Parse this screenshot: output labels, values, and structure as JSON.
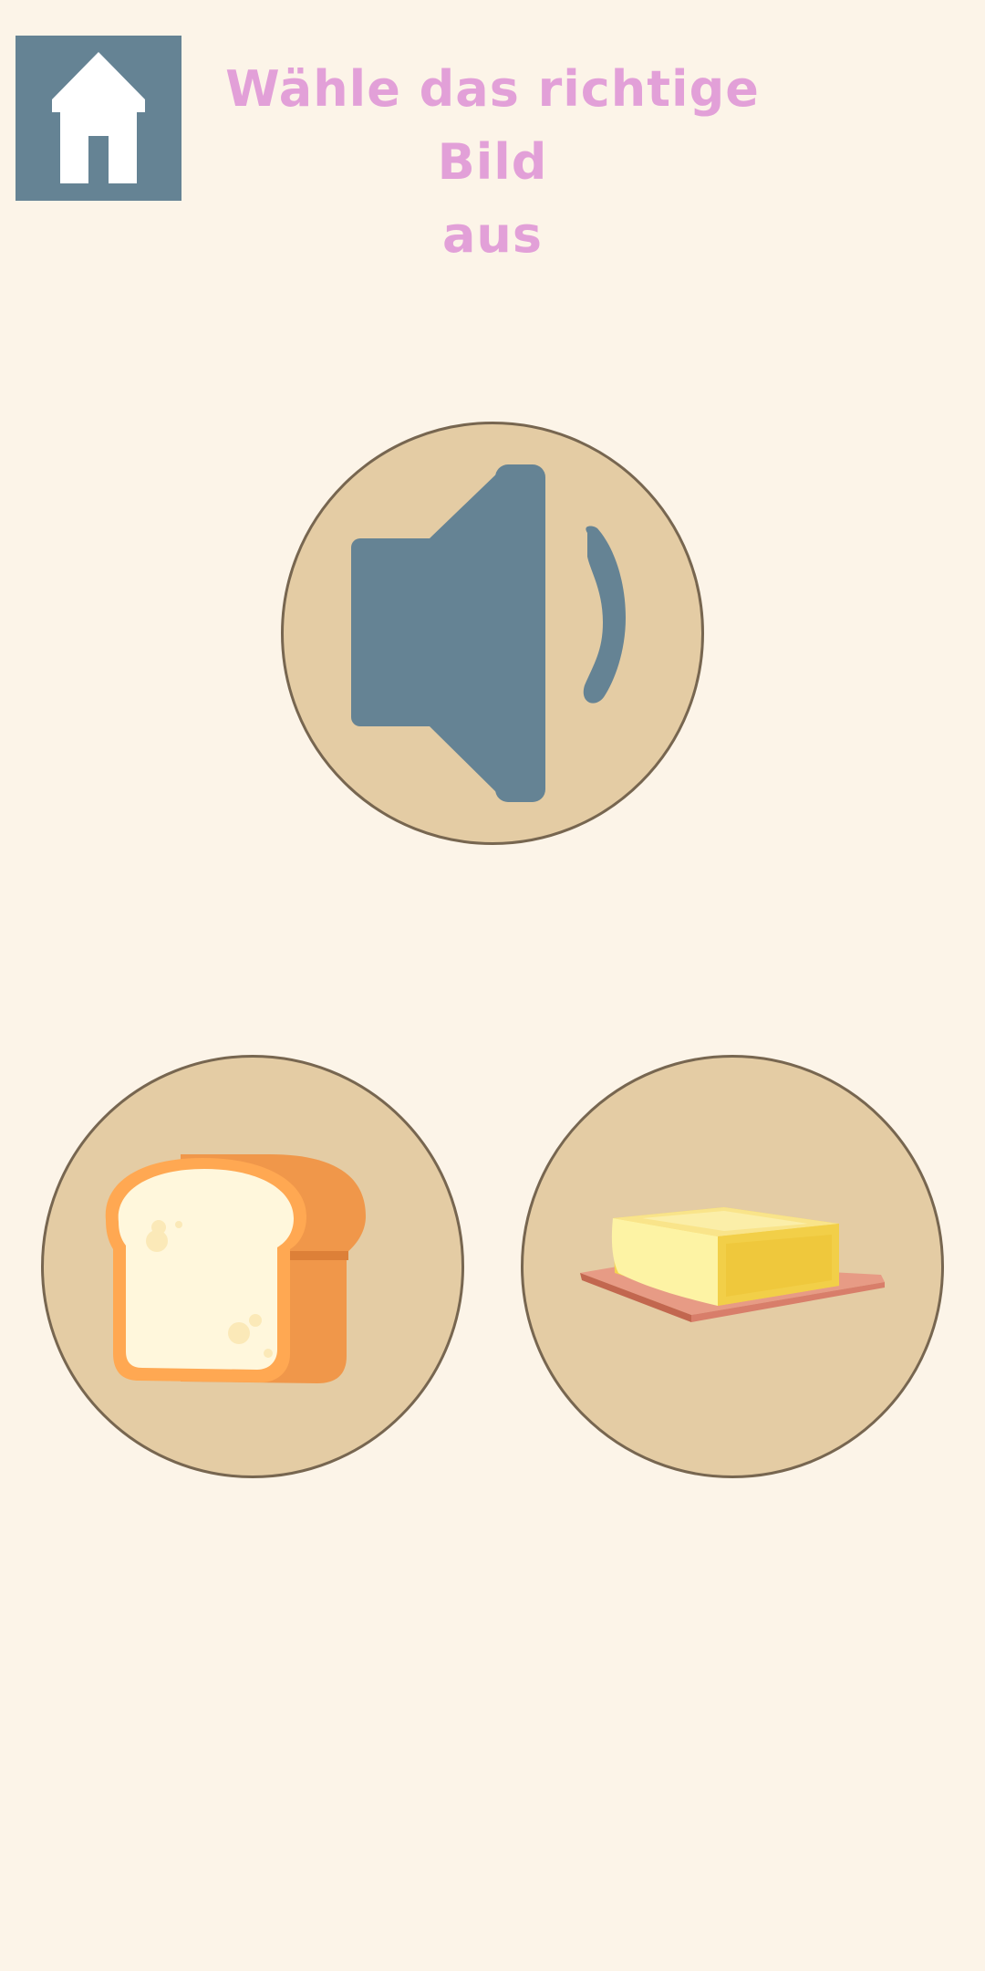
{
  "instruction": {
    "line1": "Wähle das richtige Bild",
    "line2": "aus"
  },
  "home_button": {
    "icon": "home-icon"
  },
  "audio_prompt": {
    "icon": "speaker-icon"
  },
  "options": [
    {
      "icon": "bread-icon"
    },
    {
      "icon": "butter-icon"
    }
  ],
  "colors": {
    "background": "#fcf4e8",
    "title": "#e2a0d8",
    "home_bg": "#658394",
    "circle_fill": "#e4cca4",
    "circle_border": "#776650",
    "speaker": "#658394"
  }
}
